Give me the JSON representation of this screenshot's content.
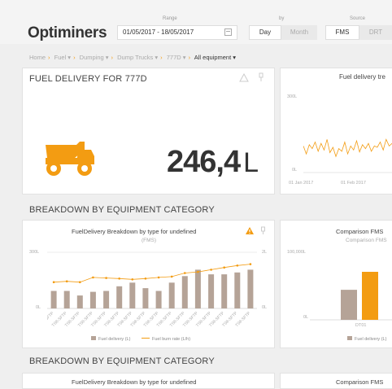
{
  "app": {
    "logo": "Optiminers"
  },
  "filters": {
    "range_label": "Range",
    "range_value": "01/05/2017 - 18/05/2017",
    "by_label": "by",
    "by_options": [
      "Day",
      "Month"
    ],
    "by_selected": "Day",
    "source_label": "Source",
    "source_options": [
      "FMS",
      "DRT"
    ],
    "source_selected": "FMS"
  },
  "breadcrumb": {
    "items": [
      "Home",
      "Fuel",
      "Dumping",
      "Dump Trucks",
      "777D",
      "All equipment"
    ]
  },
  "colors": {
    "accent": "#f39c12",
    "bar": "#b5a397",
    "line": "#f39c12"
  },
  "panel_fuel": {
    "title": "FUEL DELIVERY FOR 777D",
    "value": "246,4",
    "unit": "L",
    "icon": "dump-truck-icon"
  },
  "panel_trend": {
    "title": "Fuel delivery tre",
    "chart_data": {
      "type": "line",
      "y_labels": [
        "300L",
        "0L"
      ],
      "x_labels": [
        "01 Jan 2017",
        "01 Feb 2017"
      ],
      "series": [
        {
          "values": [
            140,
            80,
            150,
            120,
            170,
            100,
            160,
            110,
            190,
            90,
            130,
            60,
            120,
            100,
            170,
            80,
            140,
            110,
            180,
            95,
            150,
            120,
            160,
            100,
            140,
            130,
            170,
            110,
            190,
            140,
            160,
            120,
            180,
            150
          ]
        }
      ]
    }
  },
  "section1": {
    "title": "BREAKDOWN BY EQUIPMENT CATEGORY"
  },
  "chart_breakdown": {
    "title": "FuelDelivery Breakdown by type for undefined",
    "subtitle": "(FMS)",
    "chart_data": {
      "type": "bar",
      "categories": [
        "TS8-SFTP",
        "TS8-SFTP",
        "TS8-SFTP",
        "TS8-SFTP",
        "TS8-SFTP",
        "TS8-SFTP",
        "TS8-SFTP",
        "TS8-SFTP",
        "TS8-SFTP",
        "TS8-SFTP",
        "TS8-SFTP",
        "TS8-SFTP",
        "TS8-SFTP",
        "TS8-SFTP",
        "TS8-SFTP",
        "TS8-SFTP"
      ],
      "y_left_labels": [
        "300L",
        "0L"
      ],
      "y_right_labels": [
        "2L",
        "0L"
      ],
      "series": [
        {
          "name": "Fuel delivery (L)",
          "values": [
            95,
            95,
            70,
            90,
            95,
            120,
            140,
            110,
            95,
            140,
            175,
            210,
            185,
            185,
            195,
            210
          ],
          "type": "bar"
        },
        {
          "name": "Fuel burn rate (L/h)",
          "values": [
            0.95,
            0.98,
            0.95,
            1.12,
            1.1,
            1.08,
            1.05,
            1.08,
            1.12,
            1.15,
            1.28,
            1.32,
            1.4,
            1.48,
            1.55,
            1.6
          ],
          "type": "line"
        }
      ]
    }
  },
  "chart_comparison": {
    "title": "Comparison FMS",
    "subtitle": "Comparison FMS",
    "chart_data": {
      "type": "bar",
      "categories": [
        "DT01"
      ],
      "y_labels": [
        "100,000L",
        "0L"
      ],
      "series": [
        {
          "name": "Fuel delivery (L)",
          "values": [
            45000,
            72000
          ]
        }
      ]
    },
    "legend": "Fuel delivery (L)"
  },
  "section2": {
    "title": "BREAKDOWN BY EQUIPMENT CATEGORY"
  },
  "chart_breakdown_2": {
    "title": "FuelDelivery Breakdown by type for undefined"
  },
  "chart_comparison_2": {
    "title": "Comparison FMS"
  }
}
